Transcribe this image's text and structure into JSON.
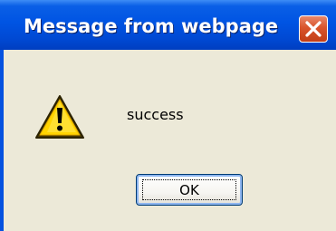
{
  "dialog": {
    "title": "Message from webpage",
    "message": "success",
    "ok_label": "OK",
    "icon": "warning-icon",
    "close_icon": "close-icon"
  },
  "colors": {
    "titlebar": "#0054e3",
    "close_button": "#d9542c",
    "body": "#ece9d8",
    "warning_yellow": "#ffd400"
  }
}
